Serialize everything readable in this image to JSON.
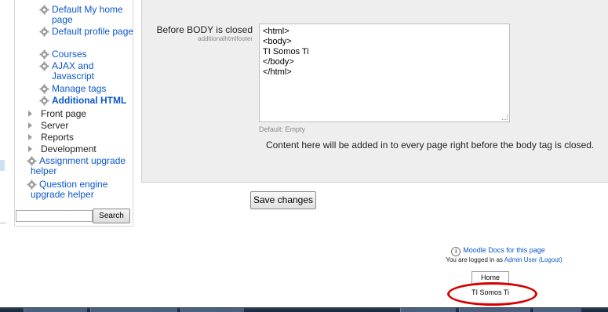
{
  "sidebar": {
    "items": [
      {
        "label": "Default My home page",
        "icon": "gear-icon"
      },
      {
        "label": "Default profile page",
        "icon": "gear-icon"
      },
      {
        "label": "Courses",
        "icon": "gear-icon"
      },
      {
        "label": "AJAX and Javascript",
        "icon": "gear-icon"
      },
      {
        "label": "Manage tags",
        "icon": "gear-icon"
      },
      {
        "label": "Additional HTML",
        "icon": "gear-icon",
        "active": true
      }
    ],
    "nodes": [
      {
        "label": "Front page"
      },
      {
        "label": "Server"
      },
      {
        "label": "Reports"
      },
      {
        "label": "Development"
      }
    ],
    "extra": [
      {
        "label": "Assignment upgrade helper",
        "icon": "gear-icon"
      },
      {
        "label": "Question engine upgrade helper",
        "icon": "gear-icon"
      }
    ],
    "search_button": "Search",
    "search_value": ""
  },
  "setting": {
    "label": "Before BODY is closed",
    "name": "additionalhtmlfooter",
    "textarea_lines": [
      "<html>",
      "<body>",
      "TI Somos Ti",
      "</body>",
      "</html>"
    ],
    "default_text": "Default: Empty",
    "description": "Content here will be added in to every page right before the body tag is closed."
  },
  "save_button": "Save changes",
  "footer": {
    "docs_link": "Moodle Docs for this page",
    "logged_prefix": "You are logged in as",
    "user_link": "Admin User",
    "logout_link": "(Logout)",
    "home_button": "Home",
    "custom_text": "TI Somos Ti"
  },
  "colors": {
    "link": "#0b57c6",
    "annotation": "#d50000"
  }
}
